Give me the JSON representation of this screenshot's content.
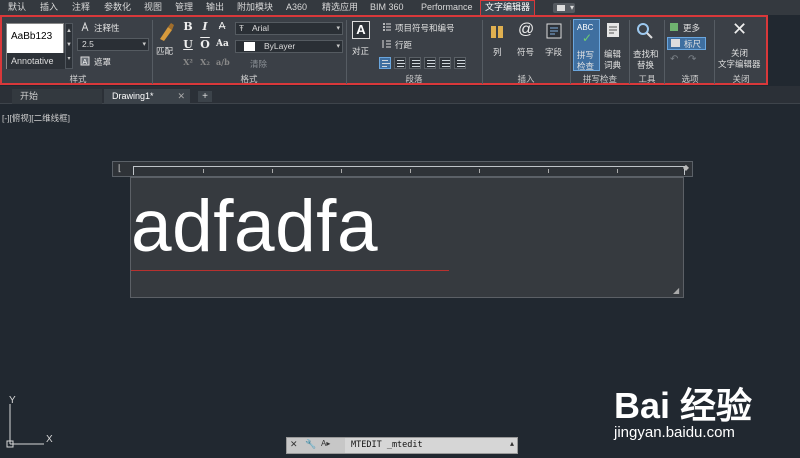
{
  "ribbon_tabs": [
    {
      "label": "默认"
    },
    {
      "label": "插入"
    },
    {
      "label": "注释"
    },
    {
      "label": "参数化"
    },
    {
      "label": "视图"
    },
    {
      "label": "管理"
    },
    {
      "label": "输出"
    },
    {
      "label": "附加模块"
    },
    {
      "label": "A360"
    },
    {
      "label": "精选应用"
    },
    {
      "label": "BIM 360"
    },
    {
      "label": "Performance"
    },
    {
      "label": "文字编辑器"
    }
  ],
  "ribbon": {
    "style": {
      "preview_sample": "AaBb123",
      "preview_name": "Annotative",
      "annotative_label": "注释性",
      "height_value": "2.5",
      "mask_label": "遮罩",
      "group_label": "样式"
    },
    "format": {
      "match_label": "匹配",
      "font_value": "Arial",
      "color_value": "ByLayer",
      "clear_label": "清除",
      "group_label": "格式"
    },
    "paragraph": {
      "justify_label": "对正",
      "bullets_label": "项目符号和编号",
      "line_spacing_label": "行距",
      "group_label": "段落"
    },
    "insert": {
      "columns_label": "列",
      "symbol_label": "符号",
      "field_label": "字段",
      "group_label": "插入"
    },
    "spell": {
      "check_label_1": "拼写",
      "check_label_2": "检查",
      "edit_dict_label_1": "编辑",
      "edit_dict_label_2": "词典",
      "group_label": "拼写检查"
    },
    "tools": {
      "find_label_1": "查找和",
      "find_label_2": "替换",
      "group_label": "工具"
    },
    "options": {
      "more_label": "更多",
      "ruler_label": "标尺",
      "group_label": "选项"
    },
    "close": {
      "close_label_1": "关闭",
      "close_label_2": "文字编辑器",
      "group_label": "关闭"
    },
    "accent_color": "#d9383a"
  },
  "doc_tabs": [
    {
      "label": "开始"
    },
    {
      "label": "Drawing1*"
    }
  ],
  "viewport": {
    "label": "[-][俯视][二维线框]",
    "text_content": "adfadfa"
  },
  "ucs": {
    "x_label": "X",
    "y_label": "Y"
  },
  "command_line": {
    "text": "MTEDIT _mtedit"
  },
  "watermark": {
    "logo": "Bai 经验",
    "url": "jingyan.baidu.com"
  }
}
